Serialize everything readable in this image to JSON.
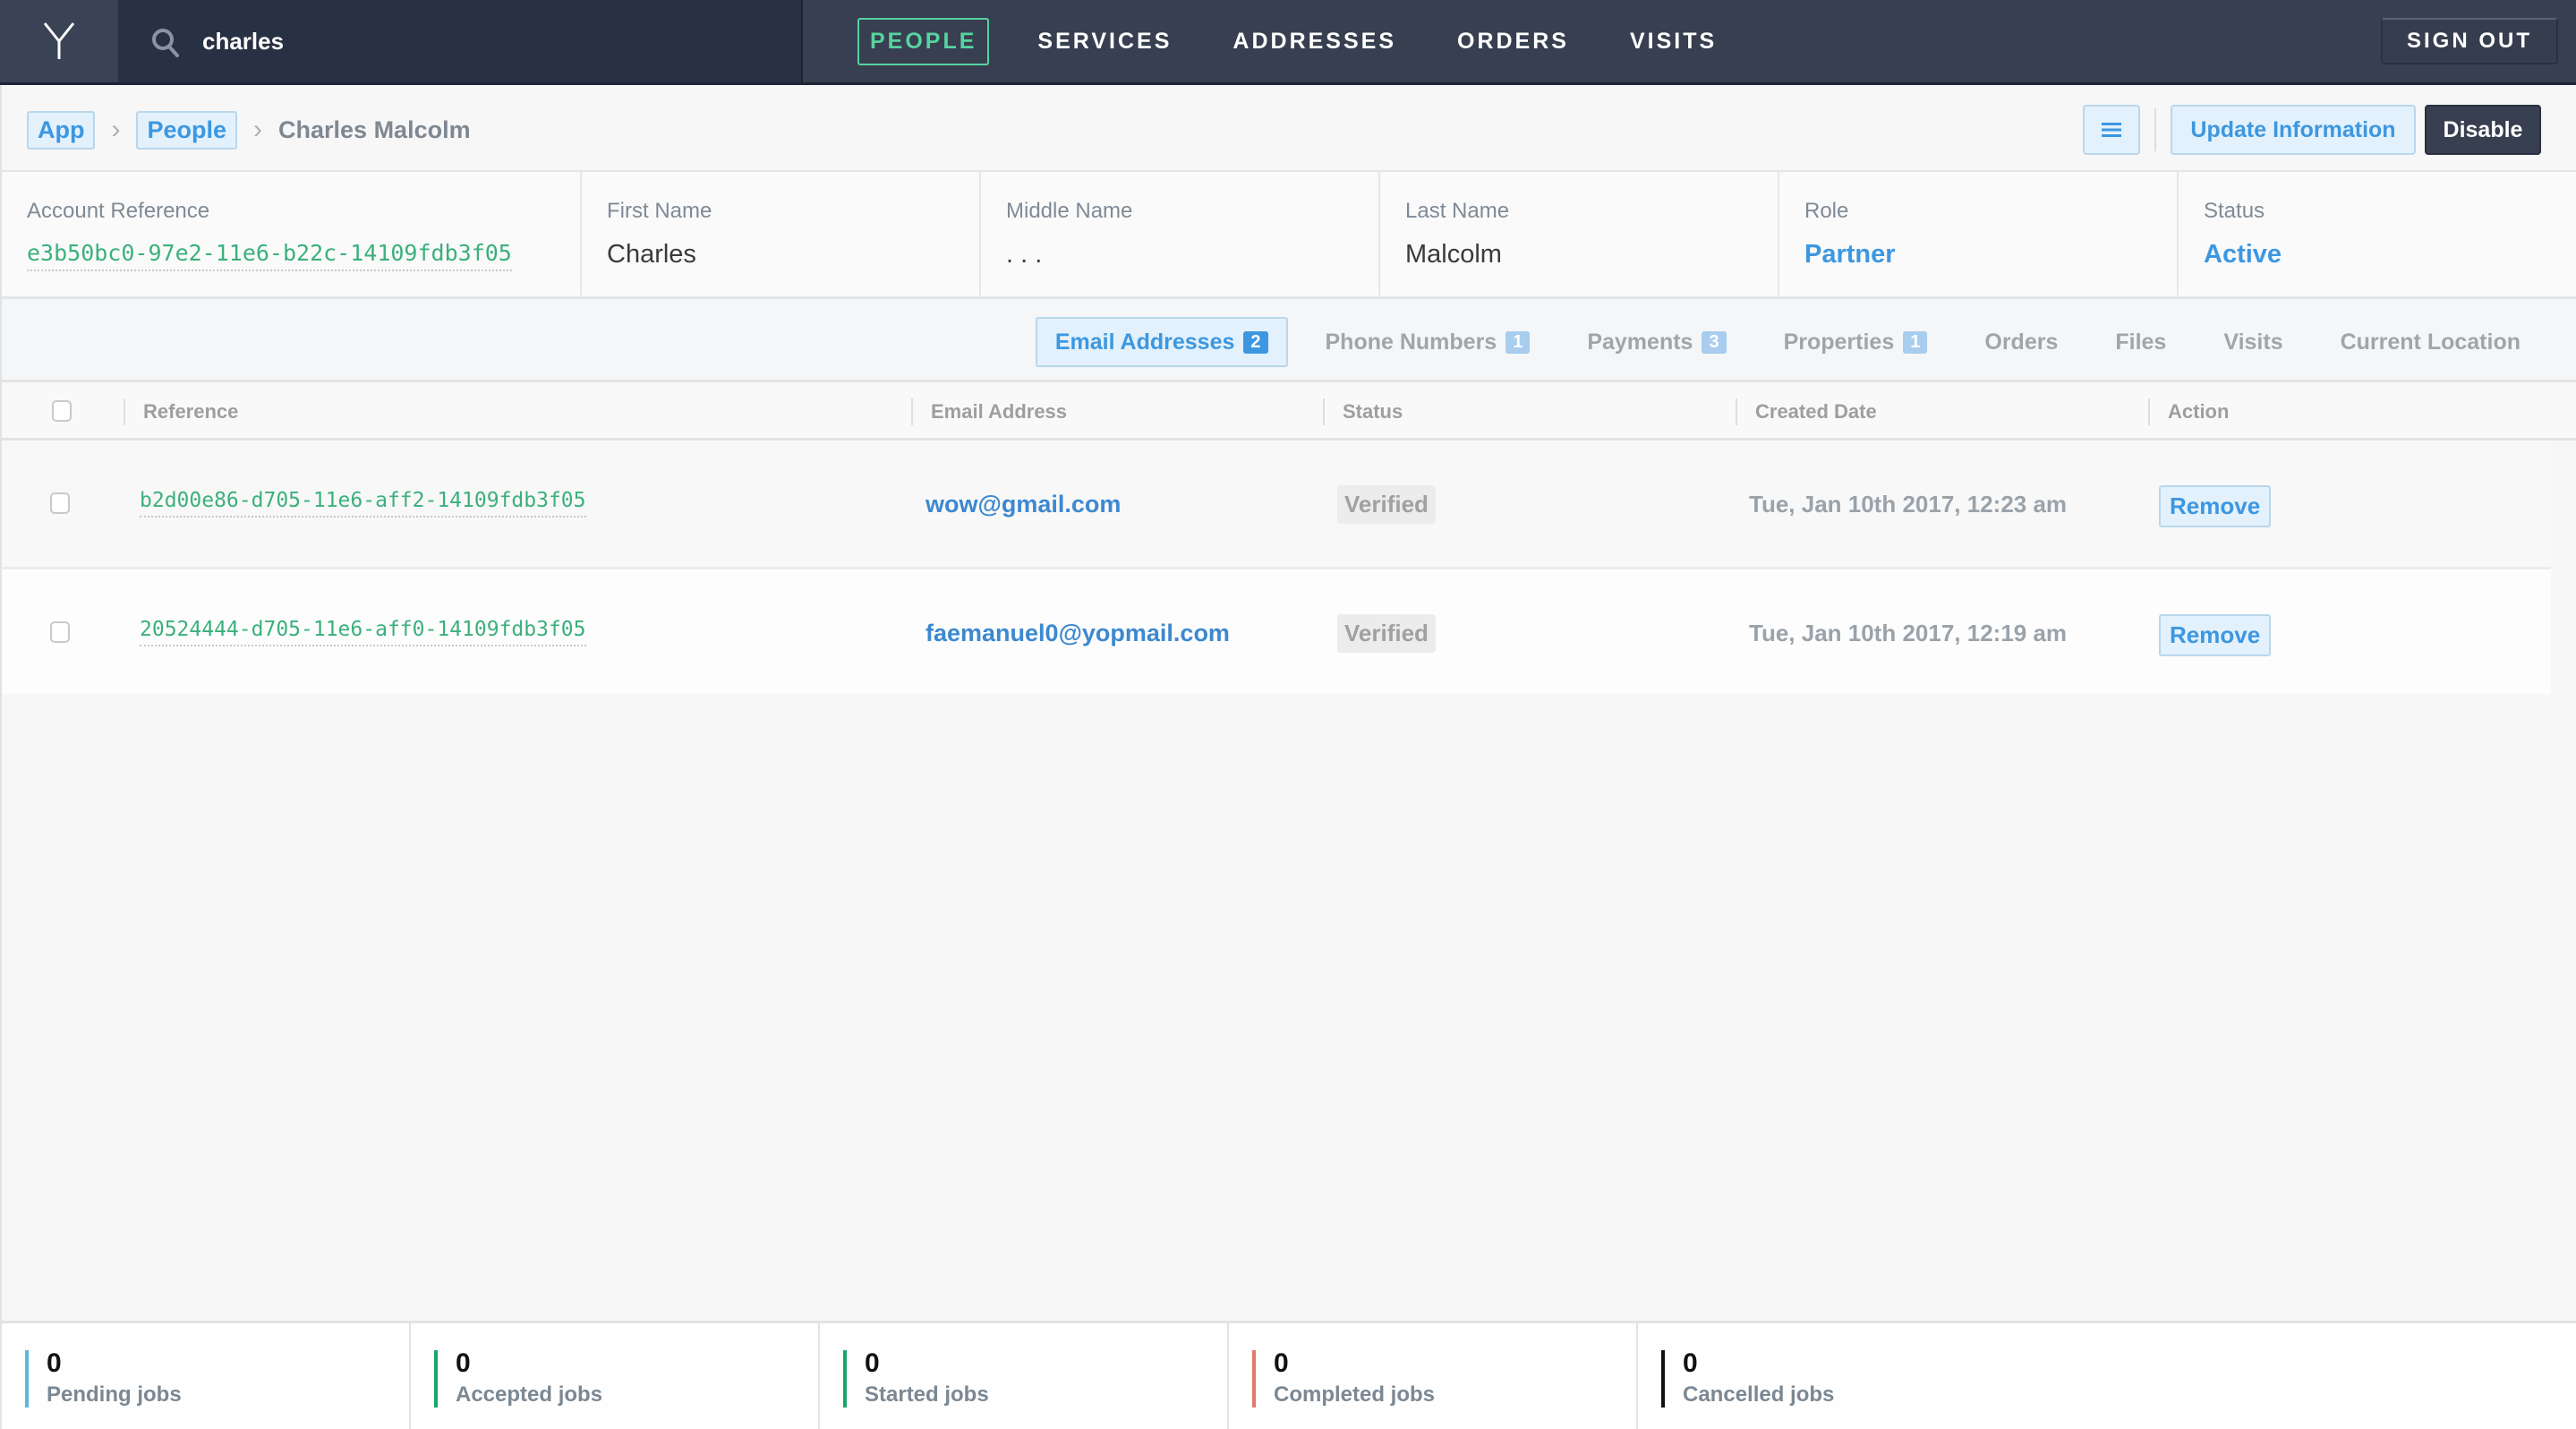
{
  "topbar": {
    "logo_icon": "y-logo-icon",
    "search": {
      "icon": "search-icon",
      "value": "charles",
      "placeholder": ""
    },
    "nav": [
      {
        "label": "PEOPLE",
        "active": true
      },
      {
        "label": "SERVICES",
        "active": false
      },
      {
        "label": "ADDRESSES",
        "active": false
      },
      {
        "label": "ORDERS",
        "active": false
      },
      {
        "label": "VISITS",
        "active": false
      }
    ],
    "signout_label": "SIGN OUT"
  },
  "breadcrumb": {
    "items": [
      "App",
      "People"
    ],
    "current": "Charles Malcolm",
    "separator_icon": "chevron-right-icon"
  },
  "actions": {
    "menu_icon": "hamburger-menu-icon",
    "update_label": "Update Information",
    "disable_label": "Disable"
  },
  "person": {
    "fields": [
      {
        "label": "Account Reference",
        "value": "e3b50bc0-97e2-11e6-b22c-14109fdb3f05"
      },
      {
        "label": "First Name",
        "value": "Charles"
      },
      {
        "label": "Middle Name",
        "value": ". . ."
      },
      {
        "label": "Last Name",
        "value": "Malcolm"
      },
      {
        "label": "Role",
        "value": "Partner"
      },
      {
        "label": "Status",
        "value": "Active"
      }
    ]
  },
  "tabs": [
    {
      "label": "Email Addresses",
      "count": "2",
      "active": true
    },
    {
      "label": "Phone Numbers",
      "count": "1",
      "active": false
    },
    {
      "label": "Payments",
      "count": "3",
      "active": false
    },
    {
      "label": "Properties",
      "count": "1",
      "active": false
    },
    {
      "label": "Orders",
      "count": null,
      "active": false
    },
    {
      "label": "Files",
      "count": null,
      "active": false
    },
    {
      "label": "Visits",
      "count": null,
      "active": false
    },
    {
      "label": "Current Location",
      "count": null,
      "active": false
    }
  ],
  "table": {
    "columns": [
      "Reference",
      "Email Address",
      "Status",
      "Created Date",
      "Action"
    ],
    "rows": [
      {
        "reference": "b2d00e86-d705-11e6-aff2-14109fdb3f05",
        "email": "wow@gmail.com",
        "status": "Verified",
        "created": "Tue, Jan 10th 2017, 12:23 am",
        "action": "Remove"
      },
      {
        "reference": "20524444-d705-11e6-aff0-14109fdb3f05",
        "email": "faemanuel0@yopmail.com",
        "status": "Verified",
        "created": "Tue, Jan 10th 2017, 12:19 am",
        "action": "Remove"
      }
    ]
  },
  "stats": [
    {
      "value": "0",
      "label": "Pending jobs",
      "color": "#5bb6e0"
    },
    {
      "value": "0",
      "label": "Accepted jobs",
      "color": "#1aa56d"
    },
    {
      "value": "0",
      "label": "Started jobs",
      "color": "#1aa56d"
    },
    {
      "value": "0",
      "label": "Completed jobs",
      "color": "#e27a6a"
    },
    {
      "value": "0",
      "label": "Cancelled jobs",
      "color": "#111111"
    }
  ],
  "colors": {
    "accent_blue": "#3d97e0",
    "accent_green": "#57d3a0",
    "reference_green": "#3bb07c",
    "topbar": "#373f50"
  }
}
